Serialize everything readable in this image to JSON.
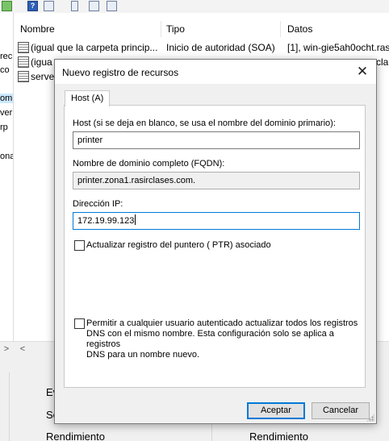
{
  "background": {
    "tree_fragments": [
      "rec",
      "co",
      "om",
      "ver",
      "rp",
      "ona"
    ],
    "columns": {
      "name": "Nombre",
      "type": "Tipo",
      "data": "Datos"
    },
    "rows": [
      {
        "name": "(igual que la carpeta princip...",
        "type": "Inicio de autoridad (SOA)",
        "data": "[1], win-gie5ah0ocht.ras"
      },
      {
        "name": "(igua",
        "type": "",
        "data": "rcla"
      },
      {
        "name": "serve",
        "type": "",
        "data": ""
      }
    ],
    "bottom": {
      "left_ev": "Ev",
      "left_se": "Se",
      "perf_left": "Rendimiento",
      "perf_right": "Rendimiento"
    }
  },
  "dialog": {
    "title": "Nuevo registro de recursos",
    "close_glyph": "✕",
    "tab_label": "Host (A)",
    "host_label": "Host (si se deja en blanco, se usa el nombre del dominio primario):",
    "host_value": "printer",
    "fqdn_label": "Nombre de dominio completo (FQDN):",
    "fqdn_value": "printer.zona1.rasirclases.com.",
    "ip_label": "Dirección IP:",
    "ip_value": "172.19.99.123",
    "ptr_checkbox_label": "Actualizar registro del puntero ( PTR) asociado",
    "ptr_checked": false,
    "allow_checkbox_label_1": "Permitir a cualquier usuario autenticado actualizar todos los registros",
    "allow_checkbox_label_2": "DNS con el mismo nombre. Esta configuración solo se aplica a registros",
    "allow_checkbox_label_3": "DNS para un nombre nuevo.",
    "allow_checked": false,
    "accept_label": "Aceptar",
    "cancel_label": "Cancelar"
  },
  "colors": {
    "focus_border": "#0078d7",
    "dialog_bg": "#f0f0f0"
  }
}
